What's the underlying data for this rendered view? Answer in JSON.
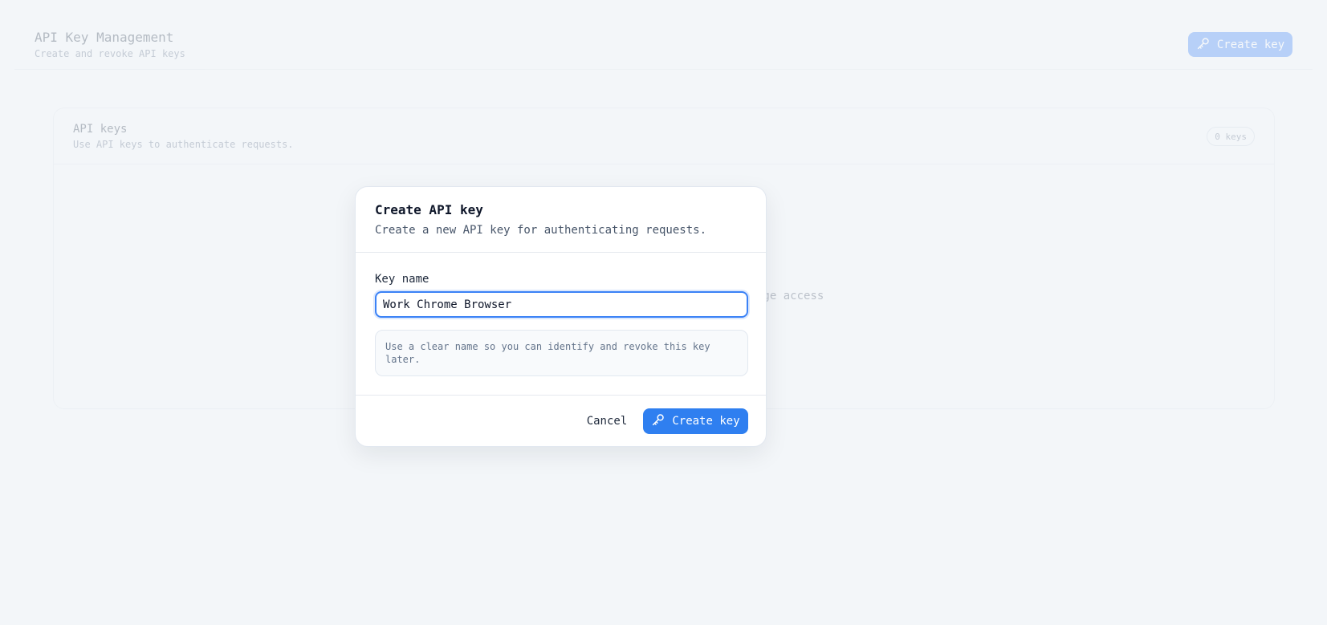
{
  "header": {
    "title": "API Key Management",
    "subtitle": "Create and revoke API keys",
    "create_button_label": "Create key"
  },
  "card": {
    "title": "API keys",
    "subtitle": "Use API keys to authenticate requests.",
    "badge": "0 keys",
    "empty_text_fragment": "age access"
  },
  "modal": {
    "title": "Create API key",
    "subtitle": "Create a new API key for authenticating requests.",
    "field_label": "Key name",
    "field_value": "Work Chrome Browser",
    "hint": "Use a clear name so you can identify and revoke this key later.",
    "cancel_label": "Cancel",
    "submit_label": "Create key"
  },
  "colors": {
    "accent": "#2f7ff0",
    "background": "#f3f6f9"
  },
  "icons": {
    "create_button": "key-icon"
  }
}
